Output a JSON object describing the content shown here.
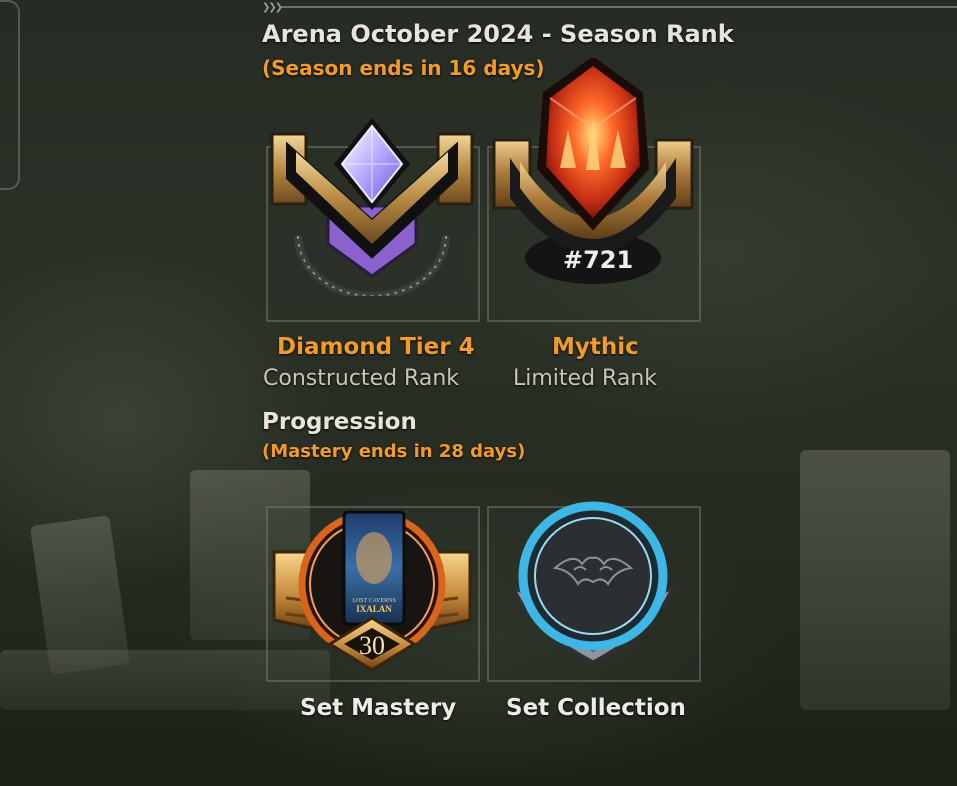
{
  "season": {
    "title": "Arena October 2024 - Season Rank",
    "ends_note": "(Season ends in 16 days)"
  },
  "ranks": [
    {
      "name": "Diamond Tier 4",
      "type": "Constructed Rank"
    },
    {
      "name": "Mythic",
      "type": "Limited Rank",
      "position": "#721"
    }
  ],
  "progression": {
    "title": "Progression",
    "ends_note": "(Mastery ends in 28 days)",
    "items": [
      {
        "label": "Set Mastery",
        "level": "30",
        "pack_text_top": "LOST CAVERNS",
        "pack_text_bottom": "IXALAN"
      },
      {
        "label": "Set Collection"
      }
    ]
  },
  "colors": {
    "accent_orange": "#f39b2a",
    "text_light": "#ecebe6",
    "text_muted": "#c9c6be",
    "collection_blue": "#3fb7e6"
  }
}
